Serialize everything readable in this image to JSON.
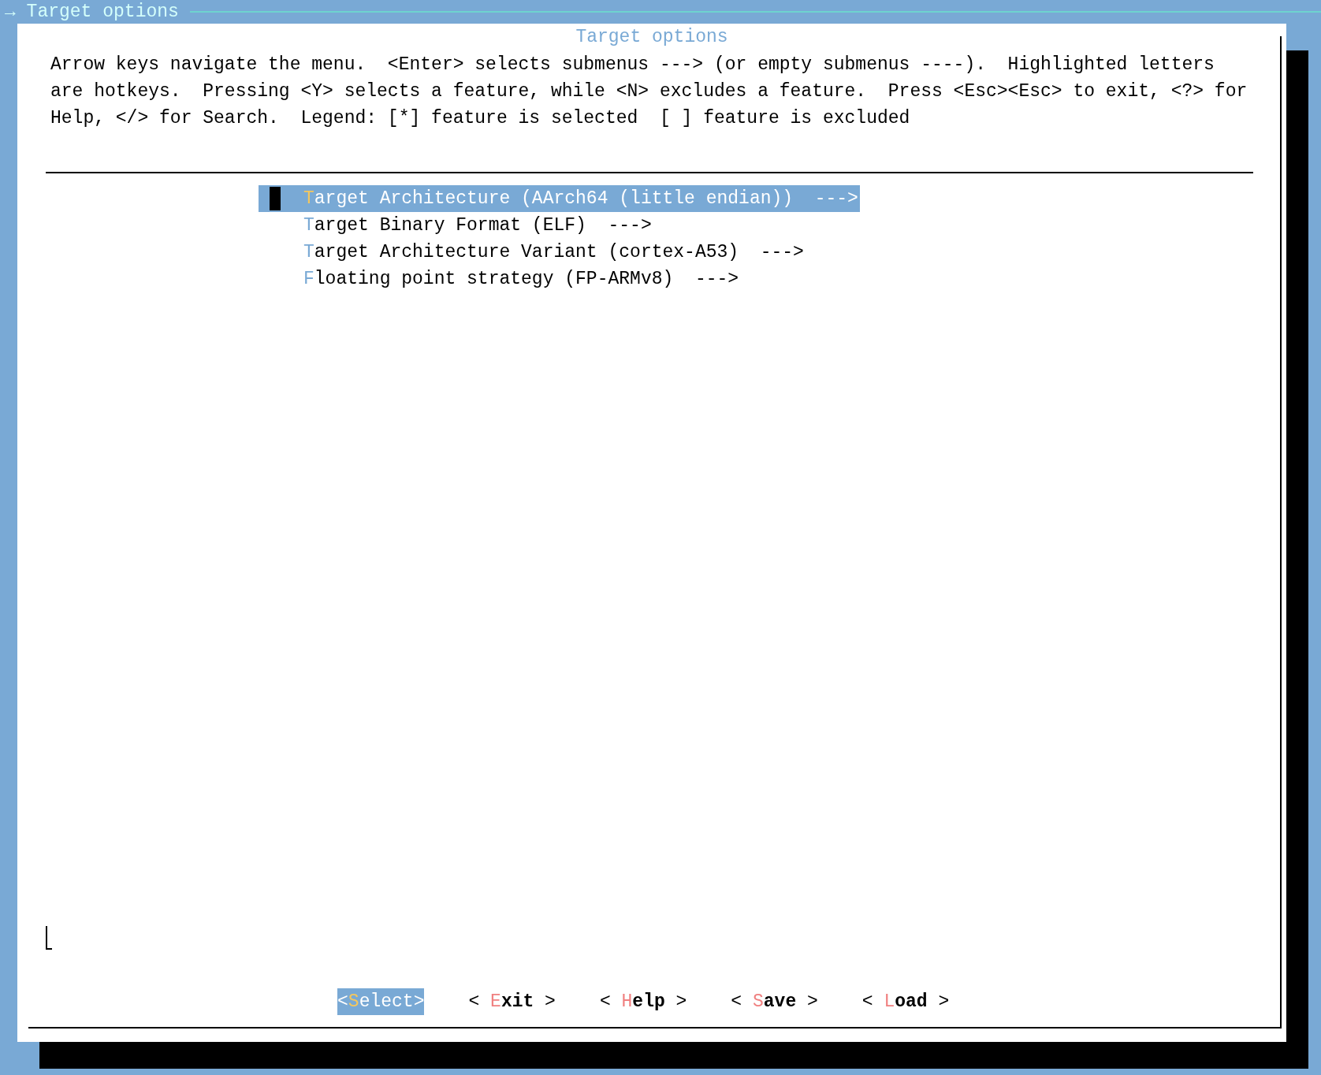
{
  "window": {
    "title": "→ Target options"
  },
  "dialog": {
    "title": "Target options",
    "help_text": [
      "Arrow keys navigate the menu.  <Enter> selects submenus ---> (or empty submenus ----).  Highlighted letters",
      "are hotkeys.  Pressing <Y> selects a feature, while <N> excludes a feature.  Press <Esc><Esc> to exit, <?> for",
      "Help, </> for Search.  Legend: [*] feature is selected  [ ] feature is excluded"
    ],
    "menu_items": [
      {
        "hotkey": "T",
        "rest": "arget Architecture (AArch64 (little endian))  --->",
        "selected": true
      },
      {
        "hotkey": "T",
        "rest": "arget Binary Format (ELF)  --->",
        "selected": false
      },
      {
        "hotkey": "T",
        "rest": "arget Architecture Variant (cortex-A53)  --->",
        "selected": false
      },
      {
        "hotkey": "F",
        "rest": "loating point strategy (FP-ARMv8)  --->",
        "selected": false
      }
    ],
    "buttons": [
      {
        "prefix": "<",
        "hotkey": "S",
        "rest": "elect",
        "suffix": ">",
        "selected": true
      },
      {
        "prefix": "< ",
        "hotkey": "E",
        "rest": "xit",
        "suffix": " >",
        "selected": false
      },
      {
        "prefix": "< ",
        "hotkey": "H",
        "rest": "elp",
        "suffix": " >",
        "selected": false
      },
      {
        "prefix": "< ",
        "hotkey": "S",
        "rest": "ave",
        "suffix": " >",
        "selected": false
      },
      {
        "prefix": "< ",
        "hotkey": "L",
        "rest": "oad",
        "suffix": " >",
        "selected": false
      }
    ]
  }
}
